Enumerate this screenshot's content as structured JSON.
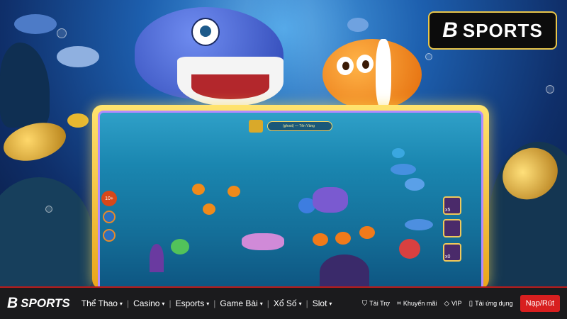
{
  "brand": {
    "logo_text": "SPORTS",
    "logo_mark": "B"
  },
  "game": {
    "top_label": "(ghost) — Tên Vàng",
    "left_badge": "10+",
    "side_buttons": [
      "x5",
      "",
      "x0"
    ]
  },
  "nav": {
    "logo_text": "SPORTS",
    "logo_mark": "B",
    "items": [
      {
        "label": "Thể Thao"
      },
      {
        "label": "Casino"
      },
      {
        "label": "Esports"
      },
      {
        "label": "Game Bài"
      },
      {
        "label": "Xổ Số"
      },
      {
        "label": "Slot"
      }
    ],
    "right": [
      {
        "label": "Tài Trợ",
        "icon": "shield-icon"
      },
      {
        "label": "Khuyến mãi",
        "icon": "tag-icon"
      },
      {
        "label": "VIP",
        "icon": "diamond-icon"
      },
      {
        "label": "Tải ứng dụng",
        "icon": "phone-icon"
      }
    ],
    "cta": "Nạp/Rút"
  },
  "colors": {
    "accent_red": "#d81f1f",
    "frame_gold": "#e9a51a",
    "nav_bg": "#1b1b1d"
  }
}
